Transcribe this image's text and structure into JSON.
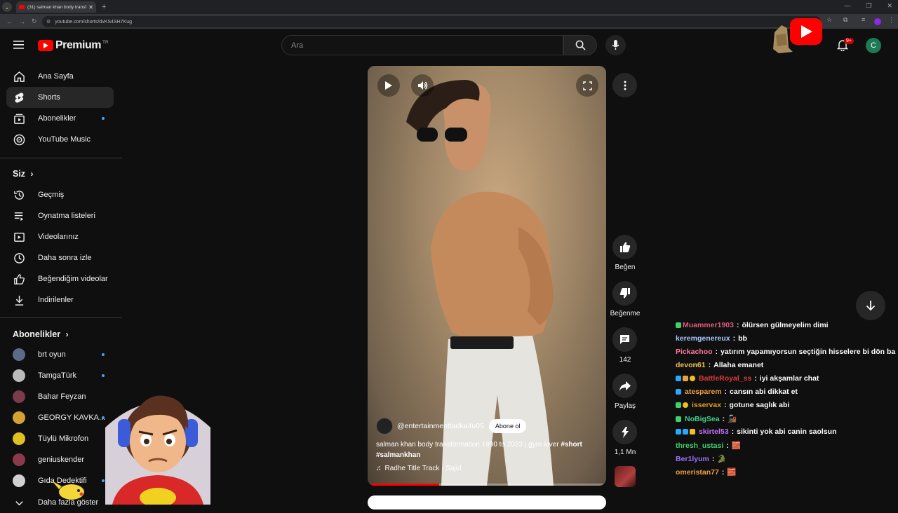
{
  "browser": {
    "tab_title": "(31) salman khan body transfor",
    "url": "youtube.com/shorts/dvKS4SH7Kug"
  },
  "header": {
    "logo_text": "Premium",
    "region": "TR",
    "search_placeholder": "Ara",
    "notification_count": "9+",
    "avatar_letter": "C"
  },
  "sidebar": {
    "main": [
      {
        "label": "Ana Sayfa",
        "icon": "home-icon"
      },
      {
        "label": "Shorts",
        "icon": "shorts-icon"
      },
      {
        "label": "Abonelikler",
        "icon": "subscriptions-icon"
      },
      {
        "label": "YouTube Music",
        "icon": "music-icon"
      }
    ],
    "you_title": "Siz",
    "you": [
      {
        "label": "Geçmiş",
        "icon": "history-icon"
      },
      {
        "label": "Oynatma listeleri",
        "icon": "playlists-icon"
      },
      {
        "label": "Videolarınız",
        "icon": "your-videos-icon"
      },
      {
        "label": "Daha sonra izle",
        "icon": "watch-later-icon"
      },
      {
        "label": "Beğendiğim videolar",
        "icon": "liked-icon"
      },
      {
        "label": "İndirilenler",
        "icon": "download-icon"
      }
    ],
    "subs_title": "Abonelikler",
    "subs": [
      {
        "label": "brt oyun",
        "color": "#5b6c8a"
      },
      {
        "label": "TamgaTürk",
        "color": "#bbbbbb"
      },
      {
        "label": "Bahar Feyzan",
        "color": "#7a3b4a"
      },
      {
        "label": "GEORGY KAVKA...",
        "color": "#d6a033"
      },
      {
        "label": "Tüylü Mikrofon",
        "color": "#e0c020"
      },
      {
        "label": "geniuskender",
        "color": "#8a3a4a"
      },
      {
        "label": "Gıda Dedektifi",
        "color": "#d0d0d0"
      }
    ],
    "show_more": "Daha fazla göster"
  },
  "video": {
    "channel": "@entertainmenttadka4u05",
    "subscribe_label": "Abone ol",
    "title": "salman khan body transformation 1990 to 2023 | gym lover",
    "tags_inline": "#short",
    "tags_line2": "#salmankhan",
    "music": "Radhe Title Track · Sajid",
    "progress": 0.3
  },
  "actions": {
    "like": "Beğen",
    "dislike": "Beğenme",
    "comments": "142",
    "share": "Paylaş",
    "remix": "1,1 Mn"
  },
  "chat": [
    {
      "user": "Muammer1903",
      "color": "#e25a7a",
      "msg": "ölürsen gülmeyelim dimi"
    },
    {
      "user": "keremgenereux",
      "color": "#a8c4ff",
      "msg": "bb"
    },
    {
      "user": "Pickachoo",
      "color": "#ff7aa0",
      "msg": "yatırım yapamıyorsun seçtiğin hisselere bi dön ba"
    },
    {
      "user": "devon61",
      "color": "#f0c050",
      "msg": "Allaha emanet"
    },
    {
      "user": "BattleRoyal_ss",
      "color": "#e03a3a",
      "msg": "iyi akşamlar chat"
    },
    {
      "user": "atesparem",
      "color": "#f0a040",
      "msg": "cansın abi dikkat et"
    },
    {
      "user": "isservax",
      "color": "#e0a020",
      "msg": "gotune saglık abi"
    },
    {
      "user": "NoBigSea",
      "color": "#40d090",
      "msg": "🚂"
    },
    {
      "user": "skirtel53",
      "color": "#c070ff",
      "msg": "sikinti yok abi canin saolsun"
    },
    {
      "user": "thresh_ustasi",
      "color": "#40d070",
      "msg": "🧱"
    },
    {
      "user": "Ber1lyum",
      "color": "#a070ff",
      "msg": "🐊"
    },
    {
      "user": "omeristan77",
      "color": "#f0a040",
      "msg": "🧱"
    }
  ]
}
